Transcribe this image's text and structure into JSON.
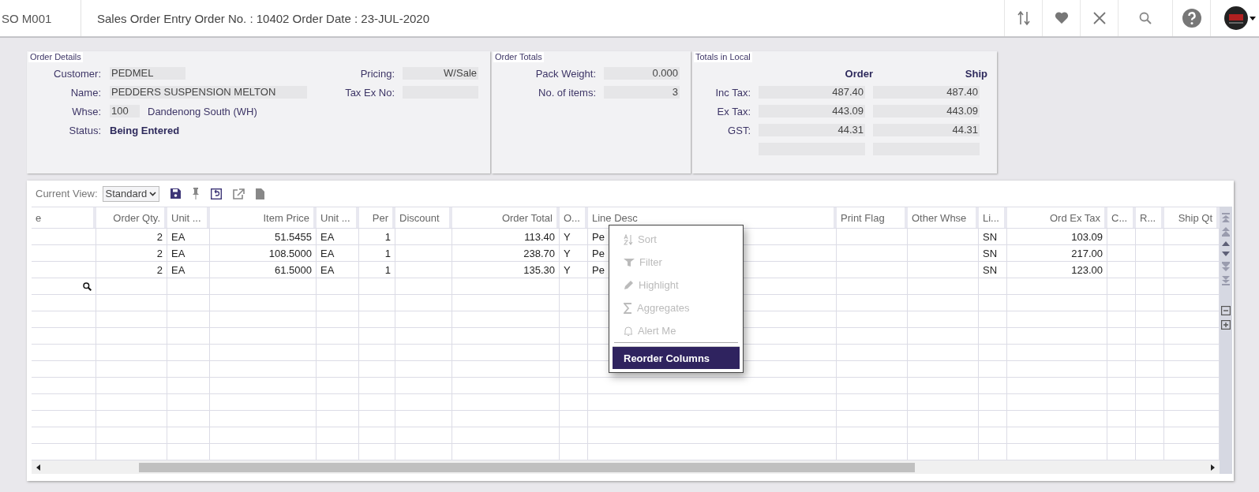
{
  "header": {
    "code": "SO M001",
    "title": "Sales Order Entry Order No. : 10402 Order Date : 23-JUL-2020"
  },
  "order_details": {
    "title": "Order Details",
    "left": [
      {
        "kind": "field",
        "label": "Customer:",
        "value": "PEDMEL"
      },
      {
        "kind": "field",
        "label": "Name:",
        "value": "PEDDERS SUSPENSION MELTON"
      },
      {
        "kind": "field",
        "label": "Whse:",
        "value": "100",
        "description": "Dandenong South (WH)"
      },
      {
        "kind": "status",
        "label": "Status:",
        "value": "Being Entered"
      }
    ],
    "right": [
      {
        "label": "Pricing:",
        "value": "W/Sale"
      },
      {
        "label": "Tax Ex No:"
      }
    ]
  },
  "order_totals": {
    "title": "Order Totals",
    "fields": [
      {
        "label": "Pack Weight:",
        "value": "0.000"
      },
      {
        "label": "No. of items:",
        "value": "3"
      }
    ]
  },
  "totals_in_local": {
    "title": "Totals in Local",
    "columns": [
      "Order",
      "Ship"
    ],
    "rows": [
      {
        "label": "Inc Tax:",
        "order": "487.40",
        "ship": "487.40"
      },
      {
        "label": "Ex Tax:",
        "order": "443.09",
        "ship": "443.09"
      },
      {
        "label": "GST:",
        "order": "44.31",
        "ship": "44.31"
      }
    ]
  },
  "grid": {
    "current_view_label": "Current View:",
    "current_view": "Standard",
    "columns": [
      "e",
      "Order Qty.",
      "Unit ...",
      "Item Price",
      "Unit ...",
      "Per",
      "Discount",
      "Order Total",
      "O...",
      "Line Desc",
      "Print Flag",
      "Other Whse",
      "Li...",
      "Ord Ex Tax",
      "C...",
      "R...",
      "Ship Qt"
    ],
    "rows": [
      {
        "order_qty": "2",
        "unit": "EA",
        "item_price": "51.5455",
        "unit_2": "EA",
        "per": "1",
        "order_total": "113.40",
        "column_9": "Y",
        "line_desc": "Pe",
        "column_13": "SN",
        "ord_ex_tax": "103.09"
      },
      {
        "order_qty": "2",
        "unit": "EA",
        "item_price": "108.5000",
        "unit_2": "EA",
        "per": "1",
        "order_total": "238.70",
        "column_9": "Y",
        "line_desc": "Pe",
        "column_13": "SN",
        "ord_ex_tax": "217.00"
      },
      {
        "order_qty": "2",
        "unit": "EA",
        "item_price": "61.5000",
        "unit_2": "EA",
        "per": "1",
        "order_total": "135.30",
        "column_9": "Y",
        "line_desc": "Pe",
        "column_13": "SN",
        "ord_ex_tax": "123.00"
      }
    ]
  },
  "context_menu": {
    "items": [
      {
        "label": "Sort",
        "disabled": true,
        "highlighted": false
      },
      {
        "label": "Filter",
        "disabled": true,
        "highlighted": false
      },
      {
        "label": "Highlight",
        "disabled": true,
        "highlighted": false
      },
      {
        "label": "Aggregates",
        "disabled": true,
        "highlighted": false
      },
      {
        "label": "Alert Me",
        "disabled": true,
        "highlighted": false
      },
      {
        "label": "Reorder Columns",
        "disabled": false,
        "highlighted": true
      }
    ]
  }
}
